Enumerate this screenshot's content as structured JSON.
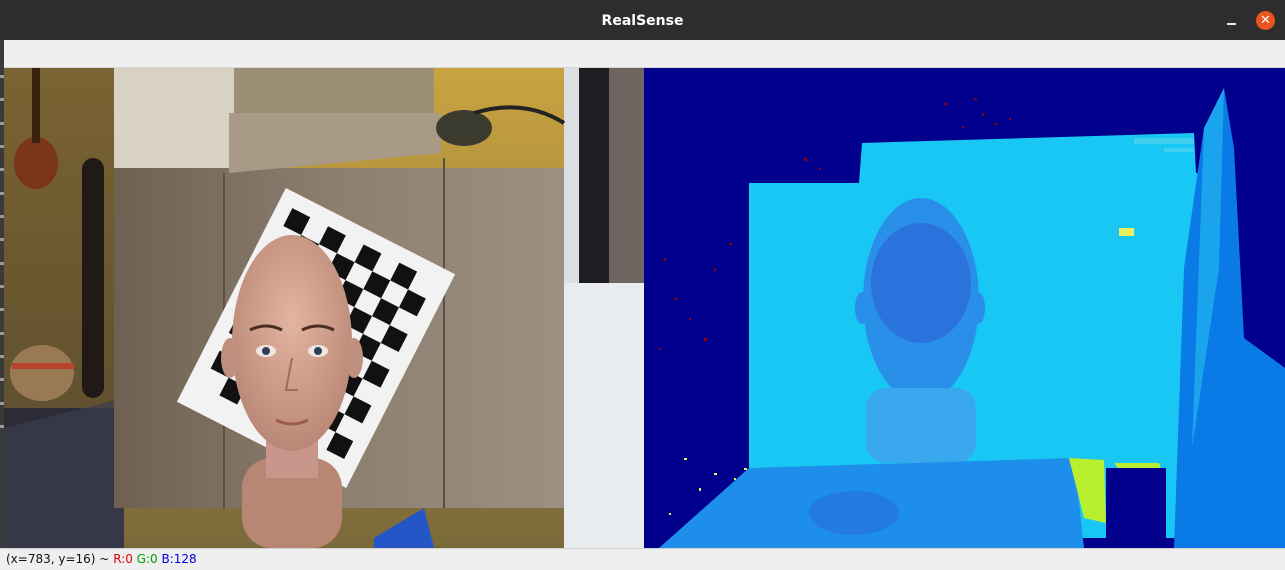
{
  "window": {
    "title": "RealSense",
    "minimize_label": "–",
    "close_label": "✕"
  },
  "views": {
    "color_stream": {
      "label": ""
    },
    "depth_stream": {
      "label": ""
    }
  },
  "status": {
    "coords": "(x=783, y=16) ~",
    "r": "R:0",
    "g": "G:0",
    "b": "B:128"
  },
  "colors": {
    "titlebar": "#2d2d2d",
    "close_button": "#e95420",
    "depth_background": "#00008c"
  }
}
